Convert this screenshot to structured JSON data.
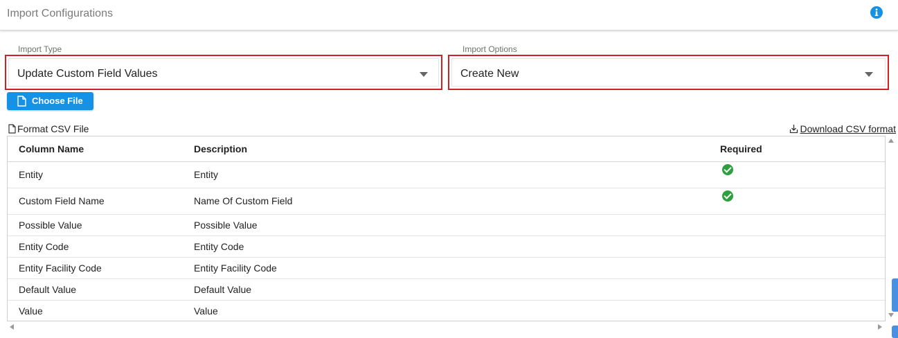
{
  "header": {
    "title": "Import Configurations",
    "info_icon": "info-icon"
  },
  "import_type": {
    "label": "Import Type",
    "value": "Update Custom Field Values"
  },
  "import_options": {
    "label": "Import Options",
    "value": "Create New"
  },
  "choose_file": {
    "label": "Choose File",
    "icon": "file-icon"
  },
  "format_csv": {
    "label": "Format CSV File",
    "icon": "file-outline-icon"
  },
  "download_csv": {
    "label": "Download CSV format",
    "icon": "download-icon"
  },
  "table": {
    "headers": [
      "Column Name",
      "Description",
      "Required"
    ],
    "rows": [
      {
        "column": "Entity",
        "description": "Entity",
        "required": true
      },
      {
        "column": "Custom Field Name",
        "description": "Name Of Custom Field",
        "required": true
      },
      {
        "column": "Possible Value",
        "description": "Possible Value",
        "required": false
      },
      {
        "column": "Entity Code",
        "description": "Entity Code",
        "required": false
      },
      {
        "column": "Entity Facility Code",
        "description": "Entity Facility Code",
        "required": false
      },
      {
        "column": "Default Value",
        "description": "Default Value",
        "required": false
      },
      {
        "column": "Value",
        "description": "Value",
        "required": false
      }
    ]
  },
  "colors": {
    "accent": "#1592e6",
    "highlight_border": "#d0202a",
    "check": "#2e9e3e"
  }
}
